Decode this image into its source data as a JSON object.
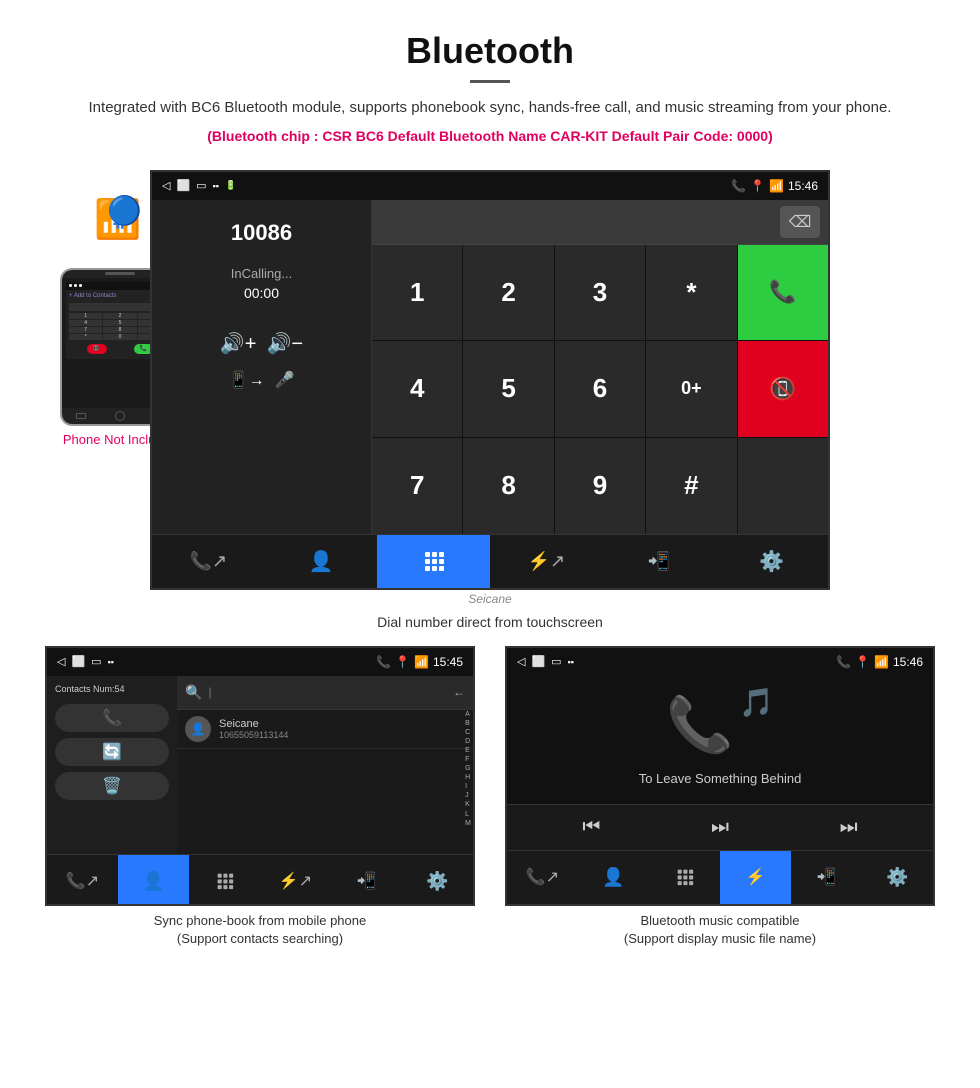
{
  "header": {
    "title": "Bluetooth",
    "description": "Integrated with BC6 Bluetooth module, supports phonebook sync, hands-free call, and music streaming from your phone.",
    "specs": "(Bluetooth chip : CSR BC6    Default Bluetooth Name CAR-KIT    Default Pair Code: 0000)"
  },
  "main_screen": {
    "status_bar": {
      "time": "15:46",
      "icons_left": [
        "back",
        "home",
        "recent",
        "signal"
      ]
    },
    "dial_number": "10086",
    "calling_label": "InCalling...",
    "timer": "00:00",
    "keys": [
      {
        "label": "1",
        "type": "normal"
      },
      {
        "label": "2",
        "type": "normal"
      },
      {
        "label": "3",
        "type": "normal"
      },
      {
        "label": "*",
        "type": "normal"
      },
      {
        "label": "call",
        "type": "green"
      },
      {
        "label": "4",
        "type": "normal"
      },
      {
        "label": "5",
        "type": "normal"
      },
      {
        "label": "6",
        "type": "normal"
      },
      {
        "label": "0+",
        "type": "normal"
      },
      {
        "label": "hangup",
        "type": "red"
      },
      {
        "label": "7",
        "type": "normal"
      },
      {
        "label": "8",
        "type": "normal"
      },
      {
        "label": "9",
        "type": "normal"
      },
      {
        "label": "#",
        "type": "normal"
      },
      {
        "label": "",
        "type": "empty"
      }
    ],
    "bottom_nav": [
      "transfer",
      "contacts",
      "keypad",
      "bluetooth",
      "phone-out",
      "settings"
    ]
  },
  "caption_main": "Dial number direct from touchscreen",
  "phonebook_screen": {
    "status_bar_time": "15:45",
    "contacts_label": "Contacts Num:54",
    "contact_name": "Seicane",
    "contact_number": "10655059113144",
    "alphabet": [
      "A",
      "B",
      "C",
      "D",
      "E",
      "F",
      "G",
      "H",
      "I",
      "J",
      "K",
      "L",
      "M"
    ],
    "caption": "Sync phone-book from mobile phone",
    "caption2": "(Support contacts searching)"
  },
  "music_screen": {
    "status_bar_time": "15:46",
    "song_title": "To Leave Something Behind",
    "caption": "Bluetooth music compatible",
    "caption2": "(Support display music file name)"
  },
  "phone_not_included": "Phone Not Included",
  "seicane_label": "Seicane"
}
